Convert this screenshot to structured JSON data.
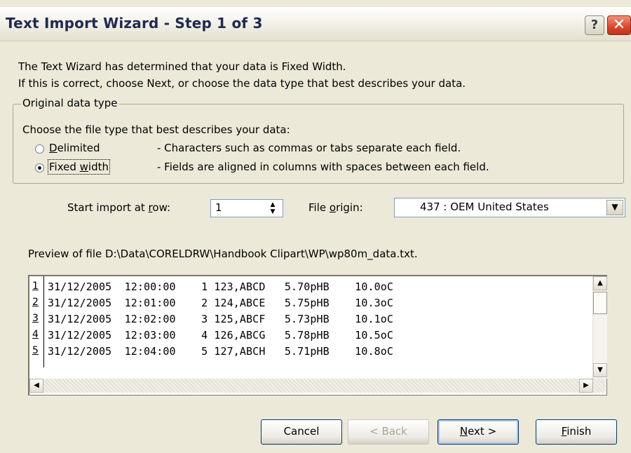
{
  "window": {
    "title": "Text Import Wizard - Step 1 of 3",
    "help_glyph": "?",
    "close_glyph": "✕"
  },
  "intro": {
    "line1": "The Text Wizard has determined that your data is Fixed Width.",
    "line2": "If this is correct, choose Next, or choose the data type that best describes your data."
  },
  "data_type": {
    "legend": "Original data type",
    "prompt": "Choose the file type that best describes your data:",
    "options": [
      {
        "label_pre": "",
        "label_key": "D",
        "label_post": "elimited",
        "description": "- Characters such as commas or tabs separate each field.",
        "selected": false
      },
      {
        "label_pre": "Fixed ",
        "label_key": "w",
        "label_post": "idth",
        "description": "- Fields are aligned in columns with spaces between each field.",
        "selected": true
      }
    ]
  },
  "start_row": {
    "label_pre": "Start import at ",
    "label_key": "r",
    "label_post": "ow:",
    "value": "1"
  },
  "file_origin": {
    "label_pre": "File ",
    "label_key": "o",
    "label_post": "rigin:",
    "value": "437 : OEM United States"
  },
  "preview": {
    "label": "Preview of file D:\\Data\\CORELDRW\\Handbook Clipart\\WP\\wp80m_data.txt.",
    "rows": [
      {
        "num": "1",
        "text": "31/12/2005  12:00:00    1 123,ABCD   5.70pHB    10.0oC"
      },
      {
        "num": "2",
        "text": "31/12/2005  12:01:00    2 124,ABCE   5.75pHB    10.3oC"
      },
      {
        "num": "3",
        "text": "31/12/2005  12:02:00    3 125,ABCF   5.73pHB    10.1oC"
      },
      {
        "num": "4",
        "text": "31/12/2005  12:03:00    4 126,ABCG   5.78pHB    10.5oC"
      },
      {
        "num": "5",
        "text": "31/12/2005  12:04:00    5 127,ABCH   5.71pHB    10.8oC"
      }
    ]
  },
  "buttons": {
    "cancel": "Cancel",
    "back": "< Back",
    "next_key": "N",
    "next_post": "ext >",
    "finish_key": "F",
    "finish_post": "inish"
  }
}
